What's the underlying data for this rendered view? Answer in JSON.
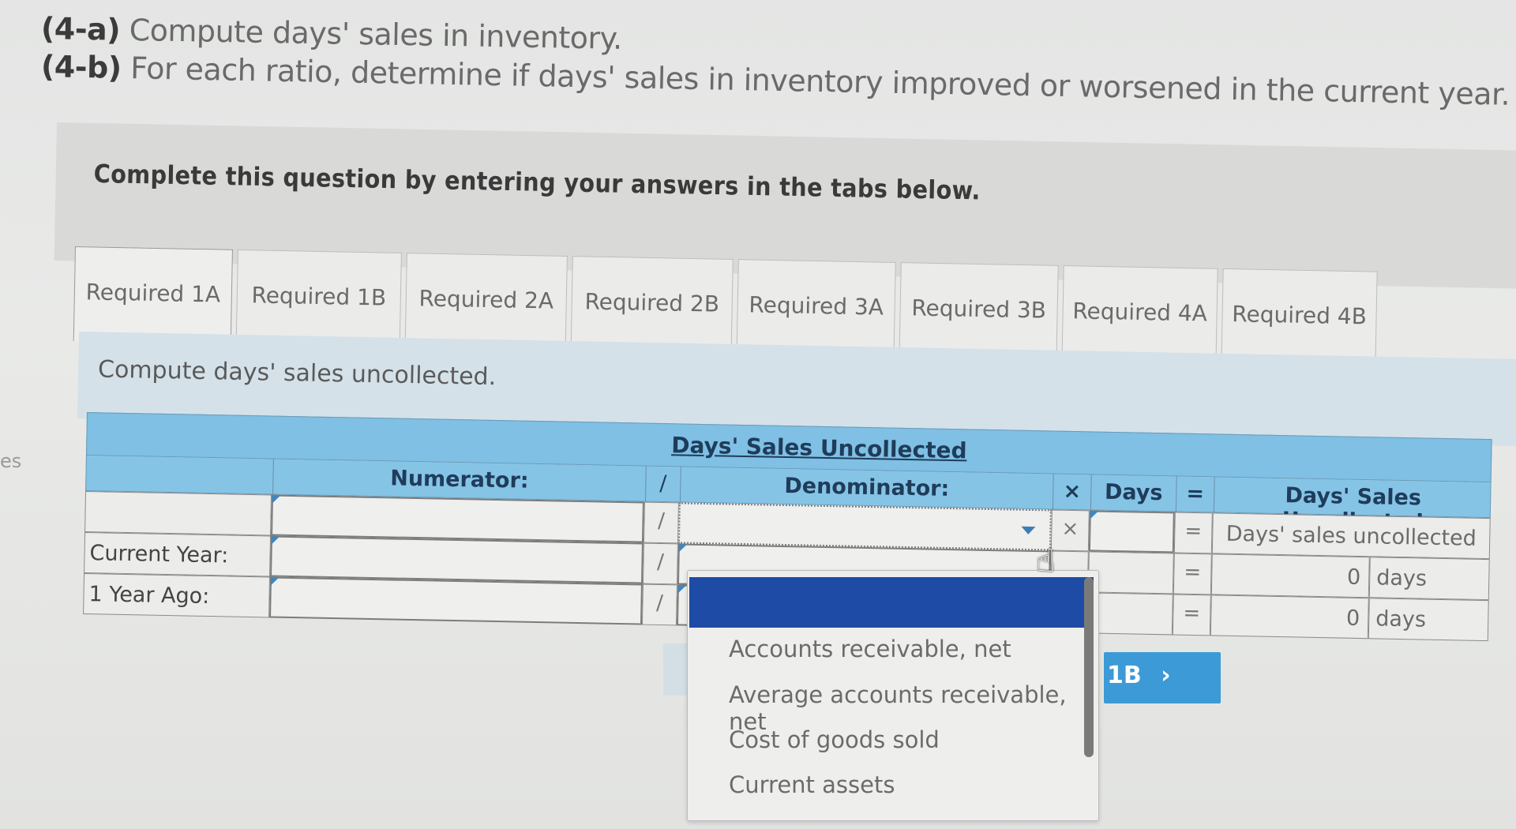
{
  "instructions": [
    {
      "tag": "(4-a)",
      "text": "Compute days' sales in inventory."
    },
    {
      "tag": "(4-b)",
      "text": "For each ratio, determine if days' sales in inventory improved or worsened in the current year."
    }
  ],
  "side_label": "es",
  "banner": {
    "text": "Complete this question by entering your answers in the tabs below."
  },
  "tabs": [
    {
      "label": "Required 1A",
      "active": true
    },
    {
      "label": "Required 1B",
      "active": false
    },
    {
      "label": "Required 2A",
      "active": false
    },
    {
      "label": "Required 2B",
      "active": false
    },
    {
      "label": "Required 3A",
      "active": false
    },
    {
      "label": "Required 3B",
      "active": false
    },
    {
      "label": "Required 4A",
      "active": false
    },
    {
      "label": "Required 4B",
      "active": false
    }
  ],
  "panel": {
    "prompt": "Compute days' sales uncollected."
  },
  "table": {
    "title": "Days' Sales Uncollected",
    "headers": {
      "numerator": "Numerator:",
      "divide": "/",
      "denominator": "Denominator:",
      "times": "×",
      "days": "Days",
      "equals": "=",
      "result": "Days' Sales Uncollected"
    },
    "rows": [
      {
        "label": "",
        "numerator": "",
        "divide": "/",
        "denominator": "",
        "times": "×",
        "days": "",
        "equals": "=",
        "result": "Days' sales uncollected",
        "unit": ""
      },
      {
        "label": "Current Year:",
        "numerator": "",
        "divide": "/",
        "denominator": "",
        "times": "",
        "days": "",
        "equals": "=",
        "result": "0",
        "unit": "days"
      },
      {
        "label": "1 Year Ago:",
        "numerator": "",
        "divide": "/",
        "denominator": "",
        "times": "",
        "days": "",
        "equals": "=",
        "result": "0",
        "unit": "days"
      }
    ]
  },
  "dropdown": {
    "selected": "",
    "options": [
      "Accounts receivable, net",
      "Average accounts receivable, net",
      "Cost of goods sold",
      "Current assets"
    ],
    "accent_color": "#1e4ba6"
  },
  "nav": {
    "next_label": "1B",
    "next_icon": "›"
  },
  "colors": {
    "header_blue": "#7fc0e4",
    "button_blue": "#3c9ad6"
  }
}
